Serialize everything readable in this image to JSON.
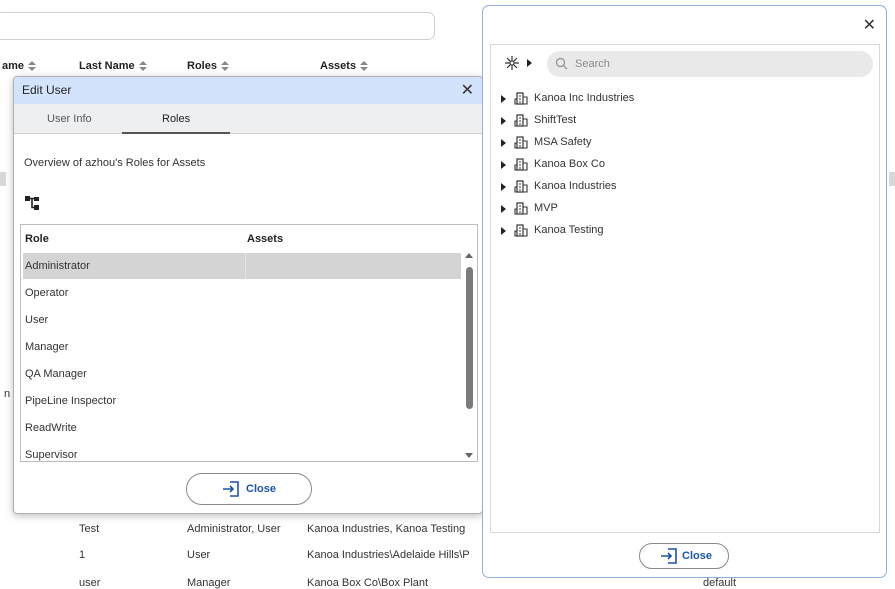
{
  "background": {
    "column_headers": [
      "ame",
      "Last Name",
      "Roles",
      "Assets"
    ],
    "rows": [
      {
        "last_name": "Test",
        "roles": "Administrator, User",
        "assets": "Kanoa Industries, Kanoa Testing"
      },
      {
        "last_name": "1",
        "roles": "User",
        "assets": "Kanoa Industries\\Adelaide Hills\\P"
      },
      {
        "last_name": "user",
        "roles": "Manager",
        "assets": "Kanoa Box Co\\Box Plant",
        "extra": "default"
      }
    ],
    "left_fragment": "n"
  },
  "edit_user": {
    "title": "Edit User",
    "tabs": [
      {
        "label": "User Info",
        "active": false
      },
      {
        "label": "Roles",
        "active": true
      }
    ],
    "overview": "Overview of azhou's Roles for Assets",
    "table": {
      "headers": [
        "Role",
        "Assets"
      ],
      "rows": [
        "Administrator",
        "Operator",
        "User",
        "Manager",
        "QA Manager",
        "PipeLine Inspector",
        "ReadWrite",
        "Supervisor"
      ],
      "selected": "Administrator"
    },
    "close_label": "Close"
  },
  "asset_panel": {
    "search_placeholder": "Search",
    "tree": [
      "Kanoa Inc Industries",
      "ShiftTest",
      "MSA Safety",
      "Kanoa Box Co",
      "Kanoa Industries",
      "MVP",
      "Kanoa Testing"
    ],
    "close_label": "Close"
  },
  "colors": {
    "header_blue": "#d3e3fb",
    "selected_row": "#d4d4d4",
    "button_text": "#1a55a8",
    "panel_border": "#8fb0d6"
  }
}
